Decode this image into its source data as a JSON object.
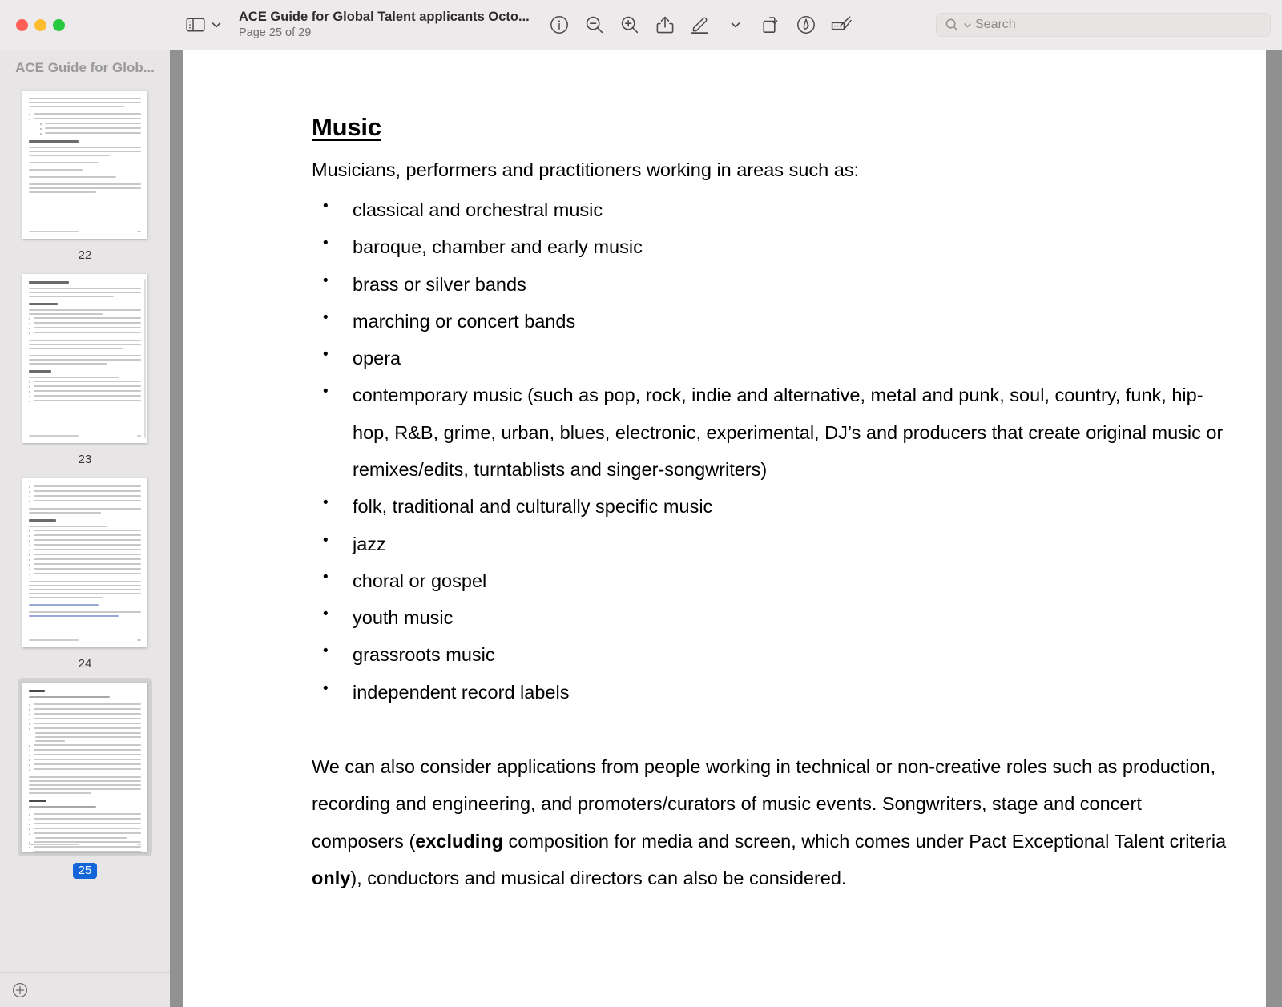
{
  "window": {
    "traffic_lights": [
      "close",
      "minimize",
      "maximize"
    ],
    "colors": {
      "close": "#ff5f57",
      "minimize": "#febc2e",
      "maximize": "#28c840",
      "accent": "#1466d8",
      "page_backdrop": "#919191"
    }
  },
  "toolbar": {
    "sidebar_toggle_label": "Sidebar",
    "sidebar_chevron_label": "Sidebar options",
    "doc_title": "ACE Guide for Global Talent applicants Octo...",
    "page_indicator": "Page 25 of 29",
    "tools": [
      {
        "name": "info-icon",
        "label": "Info"
      },
      {
        "name": "zoom-out-icon",
        "label": "Zoom Out"
      },
      {
        "name": "zoom-in-icon",
        "label": "Zoom In"
      },
      {
        "name": "share-icon",
        "label": "Share"
      },
      {
        "name": "markup-pen-icon",
        "label": "Highlight"
      },
      {
        "name": "chevron-down-icon",
        "label": "Highlight options"
      },
      {
        "name": "rotate-icon",
        "label": "Rotate"
      },
      {
        "name": "sign-icon",
        "label": "Sign"
      },
      {
        "name": "annotate-icon",
        "label": "Markup Toolbar"
      }
    ],
    "search": {
      "placeholder": "Search",
      "value": ""
    }
  },
  "sidebar": {
    "header_title": "ACE Guide for Glob...",
    "thumbnails": [
      {
        "page": "22",
        "selected": false
      },
      {
        "page": "23",
        "selected": false
      },
      {
        "page": "24",
        "selected": false
      },
      {
        "page": "25",
        "selected": true
      }
    ],
    "footer_button": {
      "name": "add-page-button",
      "label": "+"
    }
  },
  "document": {
    "heading": "Music",
    "intro": "Musicians, performers and practitioners working in areas such as:",
    "bullets": [
      "classical and orchestral music",
      "baroque, chamber and early music",
      "brass or silver bands",
      "marching or concert bands",
      "opera",
      "contemporary music (such as pop, rock, indie and alternative, metal and punk, soul, country, funk, hip-hop, R&B, grime, urban, blues, electronic, experimental, DJ’s and producers that create original music or remixes/edits, turntablists and singer-songwriters)",
      "folk, traditional and culturally specific music",
      "jazz",
      "choral or gospel",
      "youth music",
      "grassroots music",
      "independent record labels"
    ],
    "paragraph": {
      "part1": "We can also consider applications from people working in technical or non-creative roles such as production, recording and engineering, and promoters/curators of music events. Songwriters, stage and concert composers (",
      "bold1": "excluding",
      "part2": " composition for media and screen, which comes under Pact Exceptional Talent criteria ",
      "bold2": "only",
      "part3": "), conductors and musical directors can also be considered."
    }
  }
}
